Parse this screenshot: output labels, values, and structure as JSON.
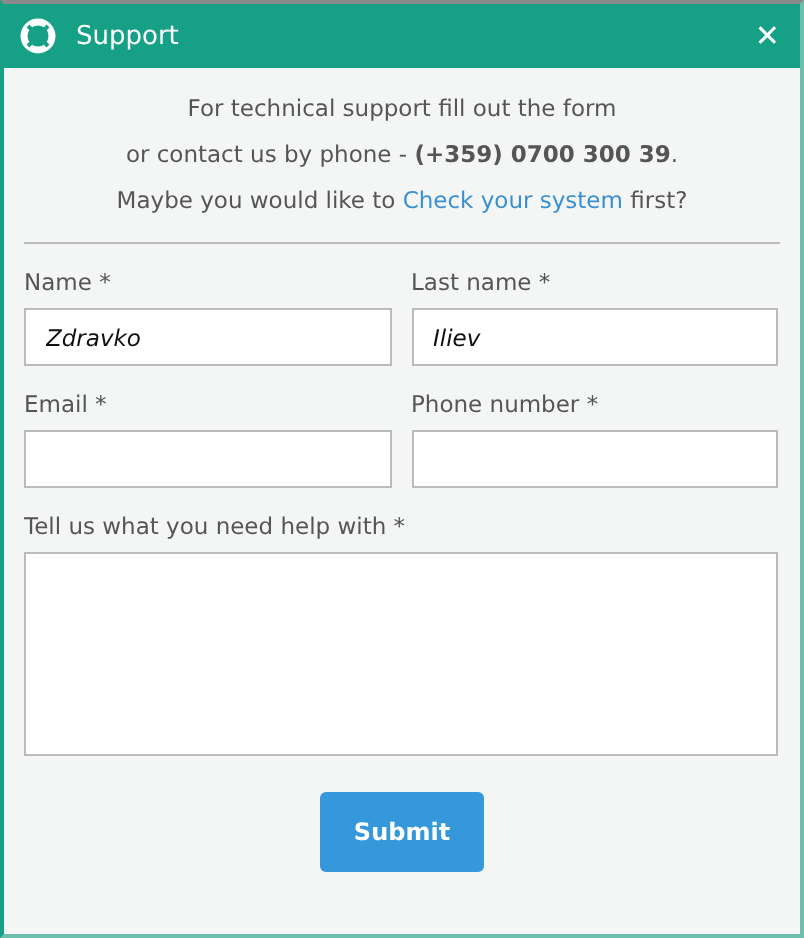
{
  "window": {
    "title": "Support",
    "close": "✕"
  },
  "intro": [
    "For technical support fill out the form",
    "or contact us by phone - **(+359) 0700 300 39**.",
    {
      "before": "Maybe you would like to ",
      "link": "Check your system",
      "after": " first?"
    }
  ],
  "fields": [
    {
      "kind": "input",
      "label": "Name *",
      "value": "Zdravko"
    },
    {
      "kind": "input",
      "label": "Last name *",
      "value": "Iliev"
    },
    {
      "kind": "input",
      "label": "Email *"
    },
    {
      "kind": "input",
      "label": "Phone number *"
    },
    {
      "kind": "textarea",
      "label": "Tell us what you need help with *"
    }
  ],
  "submit": "Submit"
}
